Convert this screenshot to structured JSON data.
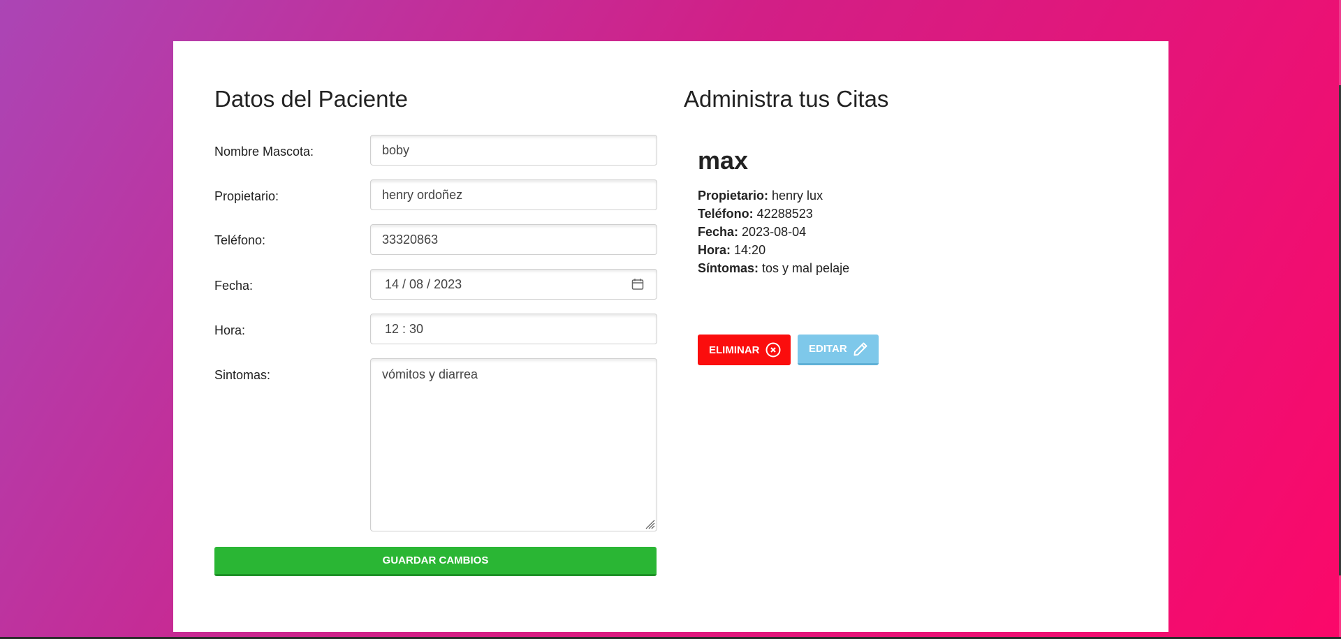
{
  "form": {
    "title": "Datos del Paciente",
    "fields": {
      "mascota": {
        "label": "Nombre Mascota:",
        "value": "boby"
      },
      "propietario": {
        "label": "Propietario:",
        "value": "henry ordoñez"
      },
      "telefono": {
        "label": "Teléfono:",
        "value": "33320863"
      },
      "fecha": {
        "label": "Fecha:",
        "day": "14",
        "month": "08",
        "year": "2023"
      },
      "hora": {
        "label": "Hora:",
        "hour": "12",
        "minute": "30"
      },
      "sintomas": {
        "label": "Sintomas:",
        "value": "vómitos y diarrea"
      }
    },
    "save_label": "GUARDAR CAMBIOS"
  },
  "citas": {
    "title": "Administra tus Citas",
    "items": [
      {
        "mascota": "max",
        "propietario_label": "Propietario:",
        "propietario": "henry lux",
        "telefono_label": "Teléfono:",
        "telefono": "42288523",
        "fecha_label": "Fecha:",
        "fecha": "2023-08-04",
        "hora_label": "Hora:",
        "hora": "14:20",
        "sintomas_label": "Síntomas:",
        "sintomas": "tos y mal pelaje",
        "delete_label": "ELIMINAR",
        "edit_label": "EDITAR"
      }
    ]
  },
  "colors": {
    "save": "#2ab634",
    "delete": "#fb0d0d",
    "edit": "#7ec8ea"
  }
}
